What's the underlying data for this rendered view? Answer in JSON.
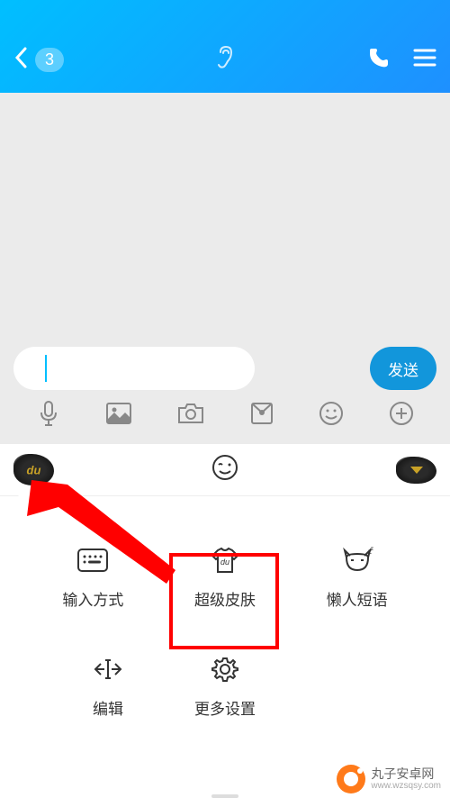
{
  "header": {
    "badge_count": "3"
  },
  "input": {
    "send_label": "发送"
  },
  "panel": {
    "items_row1": [
      {
        "label": "输入方式",
        "name": "input-method"
      },
      {
        "label": "超级皮肤",
        "name": "super-skin"
      },
      {
        "label": "懒人短语",
        "name": "lazy-phrases"
      }
    ],
    "items_row2": [
      {
        "label": "编辑",
        "name": "edit"
      },
      {
        "label": "更多设置",
        "name": "more-settings"
      }
    ]
  },
  "watermark": {
    "title": "丸子安卓网",
    "url": "www.wzsqsy.com"
  }
}
